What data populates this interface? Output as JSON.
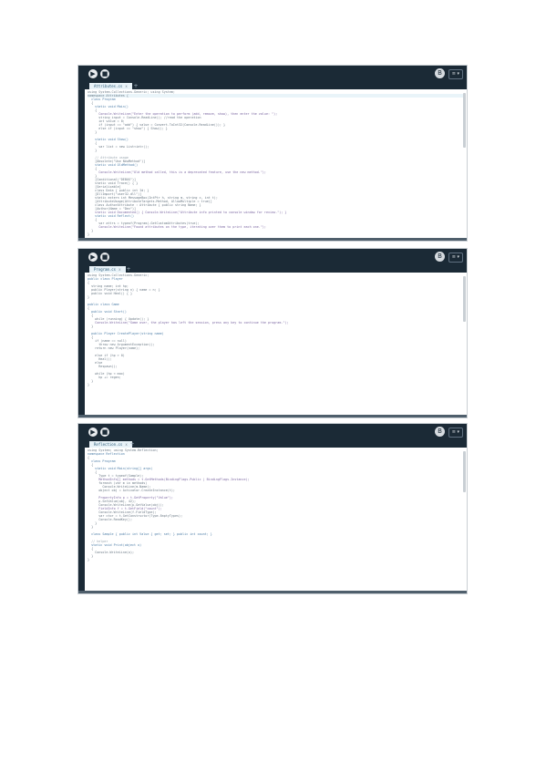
{
  "editors": [
    {
      "tab_label": "Attributes.cs",
      "tab_close": "x",
      "tab_add": "+",
      "avatar": "B",
      "menu_label": "≡ ▾",
      "ctrl_run": "▶",
      "ctrl_stop": "■",
      "code_lines": [
        "using System.Collections.Generic; using System;",
        "namespace Attributes {",
        "  class Program",
        "  {",
        "    static void Main()",
        "    {",
        "      Console.WriteLine(\"Enter the operation to perform (add, remove, show), then enter the value: \");",
        "      string input = Console.ReadLine(); //read the operation",
        "      int value = 0;",
        "      if (input == \"add\") { value = Convert.ToInt32(Console.ReadLine()); }",
        "      else if (input == \"show\") { Show(); }",
        "    }",
        "",
        "    static void Show()",
        "    {",
        "      var list = new List<int>();",
        "    }",
        "",
        "    // Attribute usage",
        "    [Obsolete(\"Use NewMethod\")]",
        "    static void OldMethod()",
        "    {",
        "      Console.WriteLine(\"Old method called, this is a deprecated feature, use the new method.\");",
        "    }",
        "    [Conditional(\"DEBUG\")]",
        "    static void Trace() { }",
        "    [Serializable]",
        "    class Data { public int Id; }",
        "    [DllImport(\"user32.dll\")]",
        "    static extern int MessageBox(IntPtr h, string m, string c, int t);",
        "    [AttributeUsage(AttributeTargets.Method, AllowMultiple = true)]",
        "    class AuthorAttribute : Attribute { public string Name; }",
        "    [Author(Name = \"Dev\")]",
        "    static void Documented() { Console.WriteLine(\"Attribute info printed to console window for review.\"); }",
        "    static void Reflect()",
        "    {",
        "      var attrs = typeof(Program).GetCustomAttributes(true);",
        "      Console.WriteLine(\"Found attributes on the type, iterating over them to print each one.\");",
        "  }",
        "}"
      ]
    },
    {
      "tab_label": "Program.cs",
      "tab_close": "x",
      "tab_add": "+",
      "avatar": "B",
      "menu_label": "≡ ▾",
      "ctrl_run": "▶",
      "ctrl_stop": "■",
      "code_lines": [
        "using System.Collections.Generic;",
        "public class Player",
        "{",
        "  string name; int hp;",
        "  public Player(string n) { name = n; }",
        "  public void Heal() { }",
        "}",
        "",
        "public class Game",
        "{",
        "  public void Start()",
        "  {",
        "    while (running) { Update(); }",
        "    Console.WriteLine(\"Game over, the player has left the session, press any key to continue the program.\");",
        "  }",
        "",
        "  public Player CreatePlayer(string name)",
        "  {",
        "    if (name == null)",
        "      throw new ArgumentException();",
        "    return new Player(name);",
        "",
        "    else if (hp > 0)",
        "      Heal();",
        "    else",
        "      Respawn();",
        "",
        "    while (hp < max)",
        "      hp += regen;",
        "  }",
        "}"
      ]
    },
    {
      "tab_label": "Reflection.cs",
      "tab_close": "x",
      "tab_add": "+",
      "avatar": "B",
      "menu_label": "≡ ▾",
      "ctrl_run": "▶",
      "ctrl_stop": "■",
      "code_lines": [
        "using System; using System.Reflection;",
        "namespace Reflection",
        "{",
        "  class Program",
        "  {",
        "    static void Main(string[] args)",
        "    {",
        "      Type t = typeof(Sample);",
        "      MethodInfo[] methods = t.GetMethods(BindingFlags.Public | BindingFlags.Instance);",
        "      foreach (var m in methods)",
        "        Console.WriteLine(m.Name);",
        "      object obj = Activator.CreateInstance(t);",
        "",
        "      PropertyInfo p = t.GetProperty(\"Value\");",
        "      p.SetValue(obj, 42);",
        "      Console.WriteLine(p.GetValue(obj));",
        "      FieldInfo f = t.GetField(\"count\");",
        "      Console.WriteLine(f.FieldType);",
        "      var ctor = t.GetConstructor(Type.EmptyTypes);",
        "      Console.ReadKey();",
        "    }",
        "  }",
        "",
        "  class Sample { public int Value { get; set; } public int count; }",
        "",
        "  // helper",
        "  static void Print(object o)",
        "  {",
        "    Console.WriteLine(o);",
        "  }",
        "}"
      ]
    }
  ]
}
